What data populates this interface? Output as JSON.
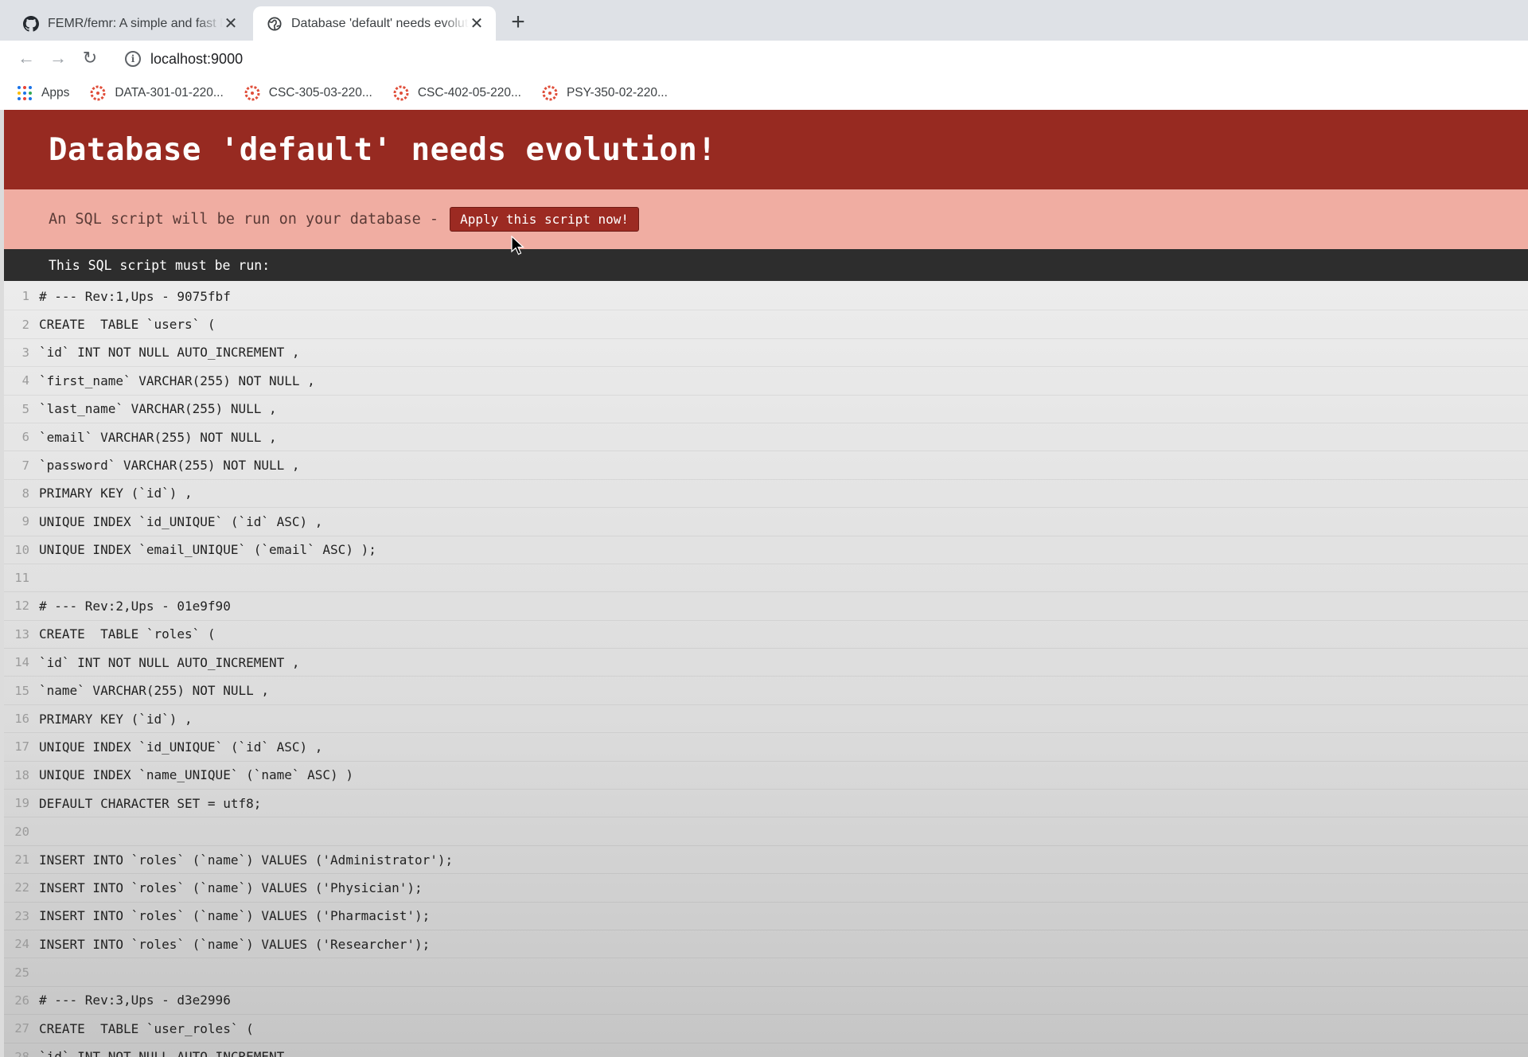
{
  "browser": {
    "tabs": [
      {
        "title": "FEMR/femr: A simple and fast EMR",
        "icon": "github-icon",
        "active": false
      },
      {
        "title": "Database 'default' needs evolution!",
        "icon": "globe-icon",
        "active": true
      }
    ],
    "new_tab_symbol": "+",
    "url": "localhost:9000",
    "bookmarks": [
      {
        "label": "Apps",
        "icon": "apps-grid-icon"
      },
      {
        "label": "DATA-301-01-220...",
        "icon": "canvas-icon"
      },
      {
        "label": "CSC-305-03-220...",
        "icon": "canvas-icon"
      },
      {
        "label": "CSC-402-05-220...",
        "icon": "canvas-icon"
      },
      {
        "label": "PSY-350-02-220...",
        "icon": "canvas-icon"
      }
    ]
  },
  "page": {
    "title": "Database 'default' needs evolution!",
    "notice_text": "An SQL script will be run on your database -",
    "apply_button": "Apply this script now!",
    "script_header": "This SQL script must be run:",
    "colors": {
      "hero": "#972a21",
      "notice": "#f0ada2",
      "header_bar": "#2d2d2d"
    }
  },
  "script_lines": [
    "# --- Rev:1,Ups - 9075fbf",
    "CREATE  TABLE `users` (",
    "`id` INT NOT NULL AUTO_INCREMENT ,",
    "`first_name` VARCHAR(255) NOT NULL ,",
    "`last_name` VARCHAR(255) NULL ,",
    "`email` VARCHAR(255) NOT NULL ,",
    "`password` VARCHAR(255) NOT NULL ,",
    "PRIMARY KEY (`id`) ,",
    "UNIQUE INDEX `id_UNIQUE` (`id` ASC) ,",
    "UNIQUE INDEX `email_UNIQUE` (`email` ASC) );",
    "",
    "# --- Rev:2,Ups - 01e9f90",
    "CREATE  TABLE `roles` (",
    "`id` INT NOT NULL AUTO_INCREMENT ,",
    "`name` VARCHAR(255) NOT NULL ,",
    "PRIMARY KEY (`id`) ,",
    "UNIQUE INDEX `id_UNIQUE` (`id` ASC) ,",
    "UNIQUE INDEX `name_UNIQUE` (`name` ASC) )",
    "DEFAULT CHARACTER SET = utf8;",
    "",
    "INSERT INTO `roles` (`name`) VALUES ('Administrator');",
    "INSERT INTO `roles` (`name`) VALUES ('Physician');",
    "INSERT INTO `roles` (`name`) VALUES ('Pharmacist');",
    "INSERT INTO `roles` (`name`) VALUES ('Researcher');",
    "",
    "# --- Rev:3,Ups - d3e2996",
    "CREATE  TABLE `user_roles` (",
    "`id` INT NOT NULL AUTO_INCREMENT ,"
  ]
}
